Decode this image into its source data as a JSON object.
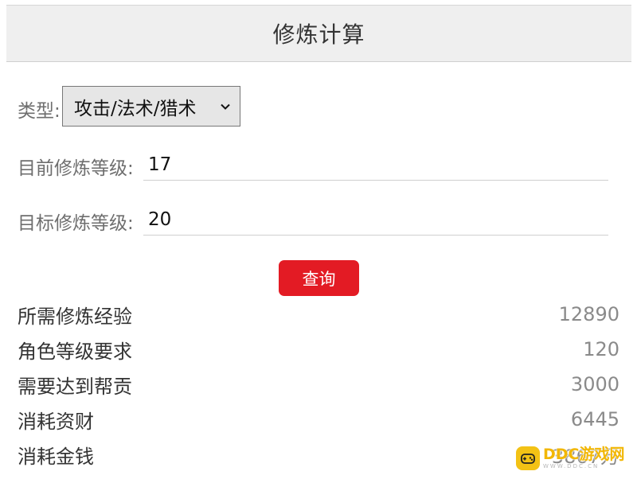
{
  "header": {
    "title": "修炼计算"
  },
  "form": {
    "type_label": "类型:",
    "type_value": "攻击/法术/猎术",
    "current_level_label": "目前修炼等级:",
    "current_level_value": "17",
    "target_level_label": "目标修炼等级:",
    "target_level_value": "20",
    "query_label": "查询"
  },
  "results": [
    {
      "label": "所需修炼经验",
      "value": "12890"
    },
    {
      "label": "角色等级要求",
      "value": "120"
    },
    {
      "label": "需要达到帮贡",
      "value": "3000"
    },
    {
      "label": "消耗资财",
      "value": "6445"
    },
    {
      "label": "消耗金钱",
      "value": "3867万"
    }
  ],
  "watermark": {
    "main": "DDC游戏网",
    "sub": "WWW.DDC.CN"
  },
  "colors": {
    "accent": "#e31b24",
    "header_bg": "#efefef",
    "watermark": "#f3c215"
  }
}
